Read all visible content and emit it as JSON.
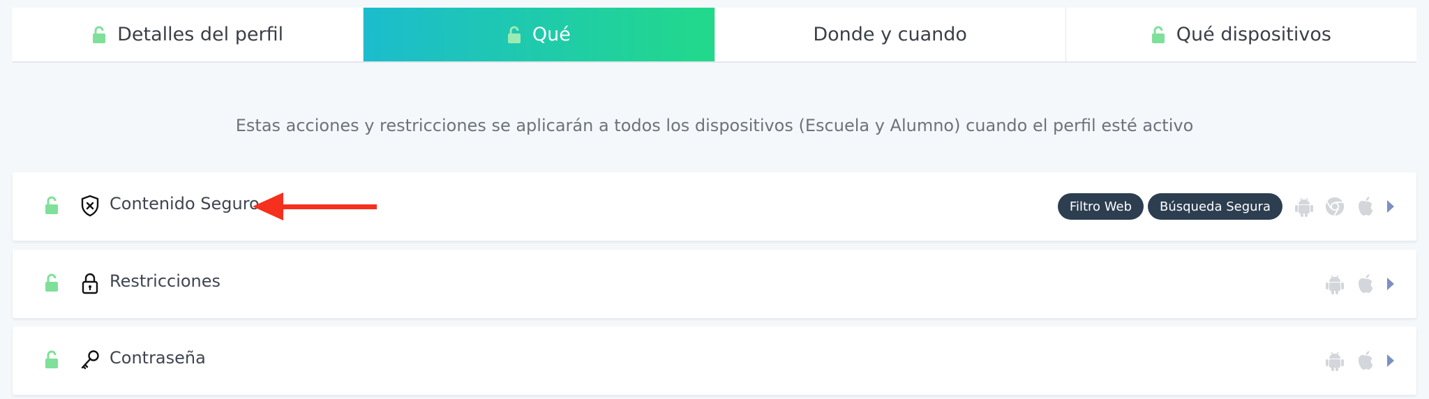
{
  "tabs": [
    {
      "label": "Detalles del perfil",
      "icon": "unlock-icon",
      "active": false
    },
    {
      "label": "Qué",
      "icon": "unlock-icon",
      "active": true
    },
    {
      "label": "Donde y cuando",
      "icon": "",
      "active": false
    },
    {
      "label": "Qué dispositivos",
      "icon": "unlock-icon",
      "active": false
    }
  ],
  "intro": {
    "text": "Estas acciones y restricciones se aplicarán a todos los dispositivos (Escuela y Alumno) cuando el perfil esté activo"
  },
  "rows": [
    {
      "label": "Contenido Seguro",
      "icon": "shield-x-icon",
      "tags": [
        "Filtro Web",
        "Búsqueda Segura"
      ],
      "platforms": [
        "android-icon",
        "chrome-icon",
        "apple-icon"
      ]
    },
    {
      "label": "Restricciones",
      "icon": "padlock-icon",
      "tags": [],
      "platforms": [
        "android-icon",
        "apple-icon"
      ]
    },
    {
      "label": "Contraseña",
      "icon": "key-icon",
      "tags": [],
      "platforms": [
        "android-icon",
        "apple-icon"
      ]
    }
  ],
  "colors": {
    "active_tab_gradient_start": "#1cbccd",
    "active_tab_gradient_end": "#22d98a",
    "unlock_green": "#7fe09a",
    "tag_background": "#2c3e50",
    "platform_icon_gray": "#d3d6da",
    "chevron_blue": "#7d8fc4",
    "annotation_arrow": "#f5301c"
  }
}
